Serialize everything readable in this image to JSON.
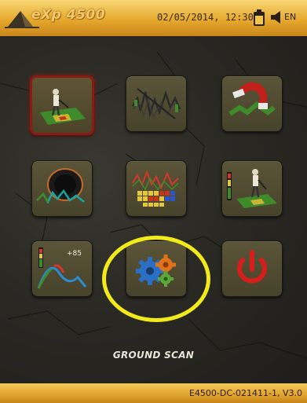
{
  "header": {
    "logo_text": "eXp 4500",
    "datetime": "02/05/2014, 12:30",
    "language": "EN"
  },
  "menu": {
    "tiles": [
      {
        "name": "ground-scan",
        "icon": "ground-scan-icon",
        "active": true
      },
      {
        "name": "magnetometer-graph",
        "icon": "signal-waveform-icon",
        "active": false
      },
      {
        "name": "magnetometer",
        "icon": "magnet-icon",
        "active": false
      },
      {
        "name": "cavity-detection",
        "icon": "cavity-icon",
        "active": false
      },
      {
        "name": "mineral-analysis",
        "icon": "periodic-table-icon",
        "active": false
      },
      {
        "name": "live-scan",
        "icon": "operator-scan-icon",
        "active": false
      },
      {
        "name": "signal-meter",
        "icon": "signal-meter-icon",
        "meter_value": "+85",
        "active": false
      },
      {
        "name": "settings",
        "icon": "gears-icon",
        "active": false
      },
      {
        "name": "power",
        "icon": "power-icon",
        "active": false
      }
    ],
    "caption": "GROUND SCAN"
  },
  "footer": {
    "version": "E4500-DC-021411-1, V3.0"
  },
  "colors": {
    "accent": "#e6a92d",
    "active_border": "#8a1a14",
    "highlight_circle": "#f3ea1a",
    "power_red": "#d81d1d"
  }
}
